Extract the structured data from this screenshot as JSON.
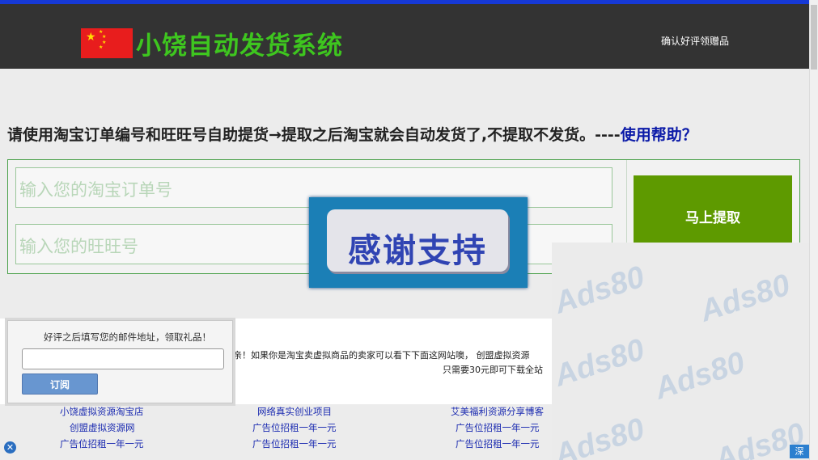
{
  "header": {
    "title": "小饶自动发货系统",
    "right_link": "确认好评领赠品"
  },
  "notice": {
    "text": "请使用淘宝订单编号和旺旺号自助提货→提取之后淘宝就会自动发货了,不提取不发货。----",
    "help_link": "使用帮助？"
  },
  "form": {
    "order_placeholder": "输入您的淘宝订单号",
    "wangwang_placeholder": "输入您的旺旺号",
    "submit_label": "马上提取"
  },
  "thanks_banner": {
    "text": "感谢支持"
  },
  "subscribe": {
    "label": "好评之后填写您的邮件地址，领取礼品！",
    "input_value": "",
    "button_label": "订阅"
  },
  "promo": {
    "line1": "亲！如果你是淘宝卖虚拟商品的卖家可以看下下面这网站噢， 创盟虚拟资源",
    "line2": "只需要30元即可下载全站"
  },
  "links": {
    "col1": [
      "小饶虚拟资源淘宝店",
      "创盟虚拟资源网",
      "广告位招租一年一元"
    ],
    "col2": [
      "网络真实创业项目",
      "广告位招租一年一元",
      "广告位招租一年一元"
    ],
    "col3": [
      "艾美福利资源分享博客",
      "广告位招租一年一元",
      "广告位招租一年一元"
    ]
  },
  "ad": {
    "watermark": "Ads80",
    "badge": "深"
  },
  "colors": {
    "header_bg": "#333333",
    "title_green": "#3ec61f",
    "submit_green": "#5e9a00",
    "help_blue": "#0b1aa8"
  }
}
